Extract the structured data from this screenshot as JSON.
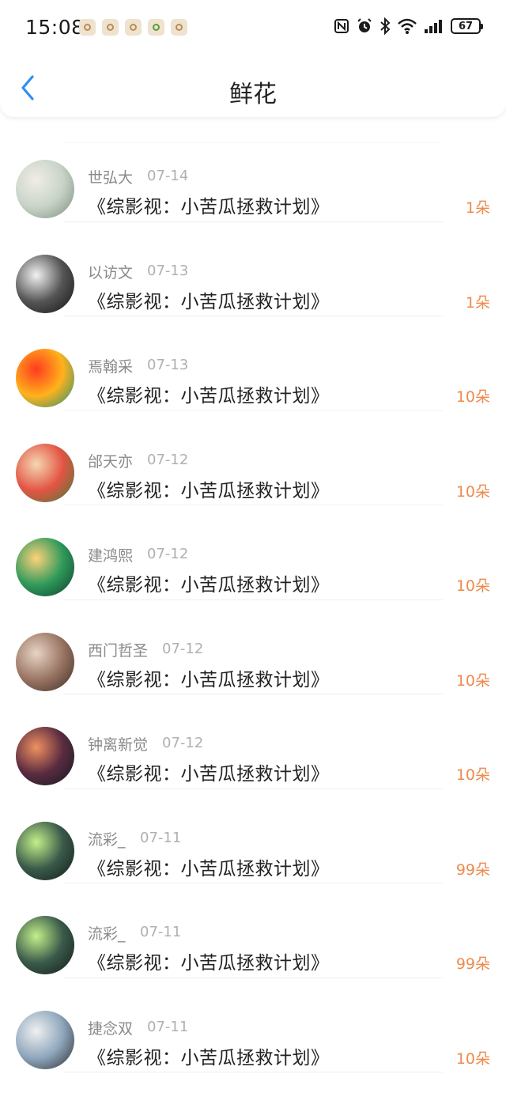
{
  "status_bar": {
    "time": "15:08",
    "battery": "67",
    "notification_icons": [
      "app-icon",
      "app-icon",
      "app-icon",
      "app-icon-green",
      "app-icon"
    ]
  },
  "nav": {
    "title": "鲜花"
  },
  "gift_list": [
    {
      "name": "世弘大",
      "date": "07-14",
      "title": "《综影视：小苦瓜拯救计划》",
      "amount": "1朵",
      "avatar_colors": [
        "#f1ede6",
        "#c8d4c8",
        "#7a8a7c"
      ]
    },
    {
      "name": "以访文",
      "date": "07-13",
      "title": "《综影视：小苦瓜拯救计划》",
      "amount": "1朵",
      "avatar_colors": [
        "#f2f2f2",
        "#555555",
        "#111111"
      ]
    },
    {
      "name": "焉翰采",
      "date": "07-13",
      "title": "《综影视：小苦瓜拯救计划》",
      "amount": "10朵",
      "avatar_colors": [
        "#ff3b1f",
        "#ffb21b",
        "#1c8f7a"
      ]
    },
    {
      "name": "邰天亦",
      "date": "07-12",
      "title": "《综影视：小苦瓜拯救计划》",
      "amount": "10朵",
      "avatar_colors": [
        "#f4d7b2",
        "#e35443",
        "#3f7e3a"
      ]
    },
    {
      "name": "建鸿熙",
      "date": "07-12",
      "title": "《综影视：小苦瓜拯救计划》",
      "amount": "10朵",
      "avatar_colors": [
        "#ffd27a",
        "#2f9a5b",
        "#0f3b2c"
      ]
    },
    {
      "name": "西门哲圣",
      "date": "07-12",
      "title": "《综影视：小苦瓜拯救计划》",
      "amount": "10朵",
      "avatar_colors": [
        "#e8d4c4",
        "#9a7564",
        "#3a2a22"
      ]
    },
    {
      "name": "钟离新觉",
      "date": "07-12",
      "title": "《综影视：小苦瓜拯救计划》",
      "amount": "10朵",
      "avatar_colors": [
        "#f09060",
        "#5a2c40",
        "#101820"
      ]
    },
    {
      "name": "流彩_",
      "date": "07-11",
      "title": "《综影视：小苦瓜拯救计划》",
      "amount": "99朵",
      "avatar_colors": [
        "#c4f08a",
        "#3a5a4a",
        "#121a16"
      ]
    },
    {
      "name": "流彩_",
      "date": "07-11",
      "title": "《综影视：小苦瓜拯救计划》",
      "amount": "99朵",
      "avatar_colors": [
        "#c4f08a",
        "#3a5a4a",
        "#121a16"
      ]
    },
    {
      "name": "捷念双",
      "date": "07-11",
      "title": "《综影视：小苦瓜拯救计划》",
      "amount": "10朵",
      "avatar_colors": [
        "#f0f0f0",
        "#8fa7bd",
        "#2a2a2a"
      ]
    }
  ]
}
